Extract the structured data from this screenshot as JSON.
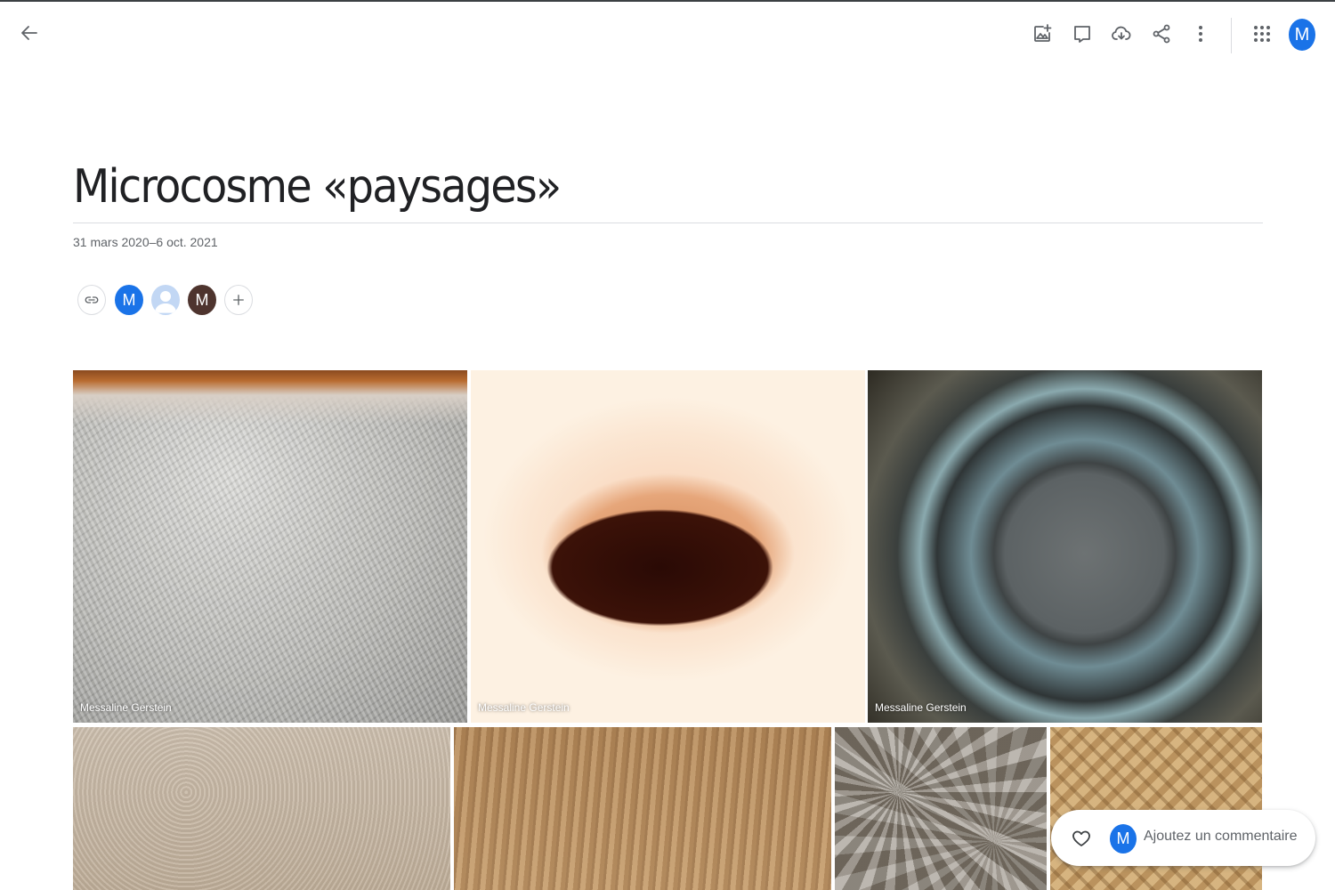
{
  "toolbar": {
    "back_icon": "arrow-back-icon",
    "actions": [
      {
        "name": "add-photos",
        "icon": "add-photo-icon"
      },
      {
        "name": "slideshow",
        "icon": "slideshow-icon"
      },
      {
        "name": "download",
        "icon": "cloud-download-icon"
      },
      {
        "name": "share",
        "icon": "share-icon"
      },
      {
        "name": "more-options",
        "icon": "more-vert-icon"
      }
    ],
    "apps_icon": "apps-grid-icon",
    "account_initial": "M"
  },
  "album": {
    "title": "Microcosme «paysages»",
    "dates": "31 mars 2020–6 oct. 2021"
  },
  "sharing": {
    "link_icon": "link-icon",
    "members": [
      {
        "initial": "M",
        "color": "#1a73e8"
      },
      {
        "initial": "",
        "color": "#c2d7f4",
        "icon": "default-person-icon"
      },
      {
        "initial": "M",
        "color": "#4e342e"
      }
    ],
    "add_icon": "add-person-icon"
  },
  "photos": [
    {
      "owner": "Messaline Gerstein",
      "subject": "white textured surface"
    },
    {
      "owner": "Messaline Gerstein",
      "subject": "hole in cream material"
    },
    {
      "owner": "Messaline Gerstein",
      "subject": "metal tube interior"
    },
    {
      "owner": "",
      "subject": "carpet texture"
    },
    {
      "owner": "",
      "subject": "wood grain"
    },
    {
      "owner": "",
      "subject": "etched glass pattern"
    },
    {
      "owner": "",
      "subject": "woven straw"
    }
  ],
  "comment_bar": {
    "like_icon": "heart-outline-icon",
    "avatar_initial": "M",
    "placeholder": "Ajoutez un commentaire"
  },
  "colors": {
    "accent": "#1a73e8",
    "icon_gray": "#5f6368",
    "divider": "#dadce0"
  }
}
